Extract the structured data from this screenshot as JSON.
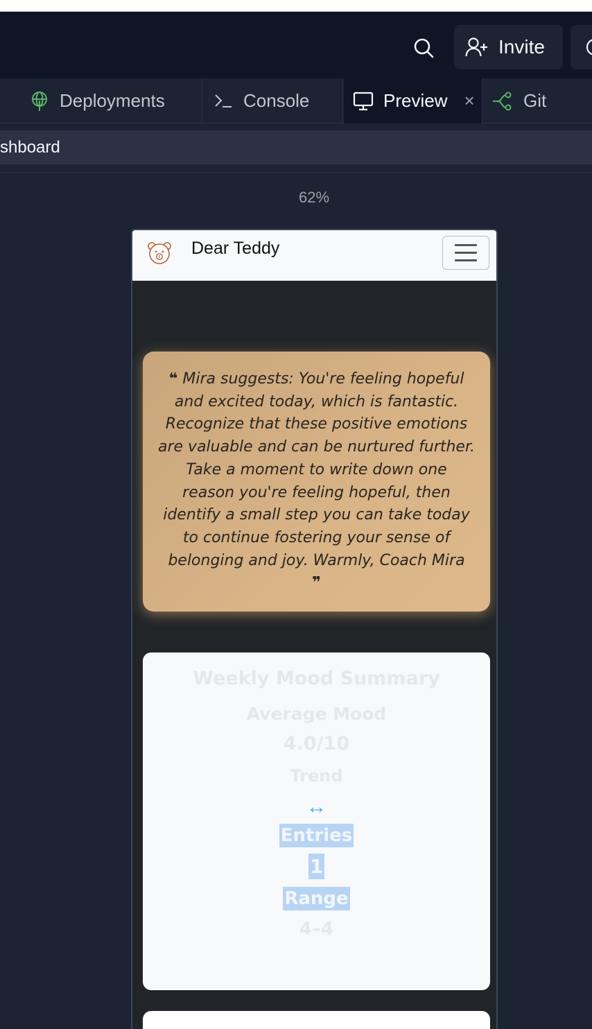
{
  "header": {
    "invite_label": "Invite"
  },
  "tabs": [
    {
      "label": "Deployments",
      "icon": "globe-icon"
    },
    {
      "label": "Console",
      "icon": "terminal-icon"
    },
    {
      "label": "Preview",
      "icon": "monitor-icon",
      "active": true,
      "close": "×"
    },
    {
      "label": "Git",
      "icon": "git-branch-icon"
    }
  ],
  "pathbar": {
    "text": "shboard"
  },
  "preview": {
    "zoom": "62%",
    "app": {
      "brand": "Dear Teddy",
      "quote": {
        "open_mark": "❝",
        "text": "Mira suggests: You're feeling hopeful and excited today, which is fantastic. Recognize that these positive emotions are valuable and can be nurtured further. Take a moment to write down one reason you're feeling hopeful, then identify a small step you can take today to continue fostering your sense of belonging and joy. Warmly, Coach Mira",
        "close_mark": "❞"
      },
      "summary": {
        "title": "Weekly Mood Summary",
        "avg_label": "Average Mood",
        "avg_value": "4.0/10",
        "trend_label": "Trend",
        "trend_icon": "↔",
        "entries_label": "Entries",
        "entries_value": "1",
        "range_label": "Range",
        "range_value": "4–4"
      }
    }
  },
  "colors": {
    "ide_bg": "#1c2333",
    "header_bg": "#0e1525",
    "quote_card": "#d8b487",
    "trend_icon": "#4fb8d8",
    "selection": "#b8d4f5"
  }
}
